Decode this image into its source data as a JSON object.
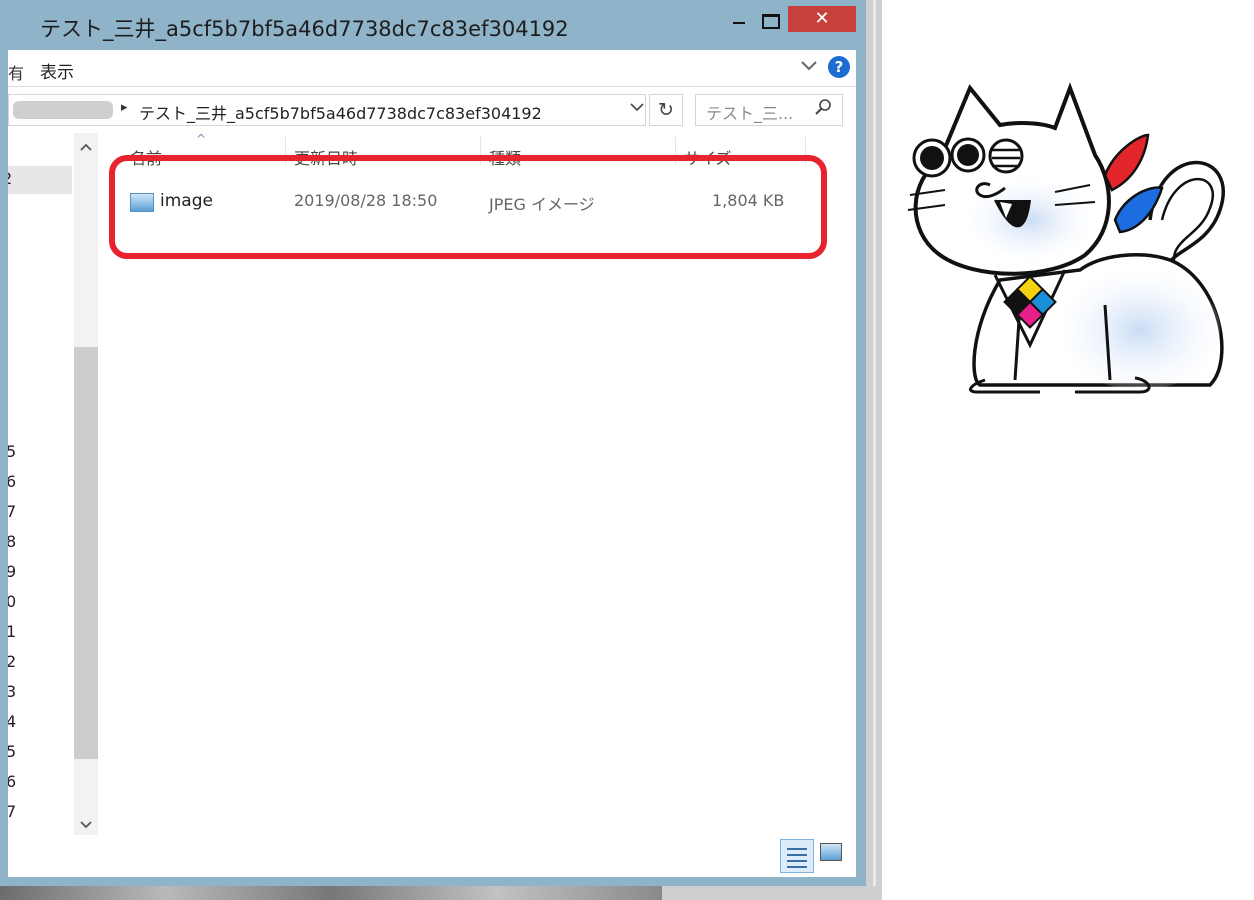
{
  "window": {
    "title": "テスト_三井_a5cf5b7bf5a46d7738dc7c83ef304192",
    "close_glyph": "✕"
  },
  "ribbon": {
    "cut_tab": "有",
    "view_tab": "表示",
    "expand_icon": "chevron-down-icon",
    "help_label": "?"
  },
  "address": {
    "separator": "▸",
    "path": "テスト_三井_a5cf5b7bf5a46d7738dc7c83ef304192",
    "dropdown": "⌄",
    "refresh": "↻",
    "search_placeholder": "テスト_三...",
    "search_icon": "⚲"
  },
  "nav": {
    "selected_text": "2",
    "up_arrow": "⌃",
    "down_arrow": "⌄",
    "numbers": [
      "5",
      "6",
      "7",
      "8",
      "9",
      "0",
      "1",
      "2",
      "3",
      "4",
      "5",
      "6",
      "7"
    ]
  },
  "filelist": {
    "columns": [
      "名前",
      "更新日時",
      "種類",
      "サイズ"
    ],
    "sort_arrow": "^",
    "rows": [
      {
        "name": "image",
        "date": "2019/08/28 18:50",
        "type": "JPEG イメージ",
        "size": "1,804 KB"
      }
    ]
  },
  "colors": {
    "frame": "#8fb3c8",
    "close": "#c7403b",
    "highlight": "#e8232f",
    "help": "#1d6dd1"
  }
}
